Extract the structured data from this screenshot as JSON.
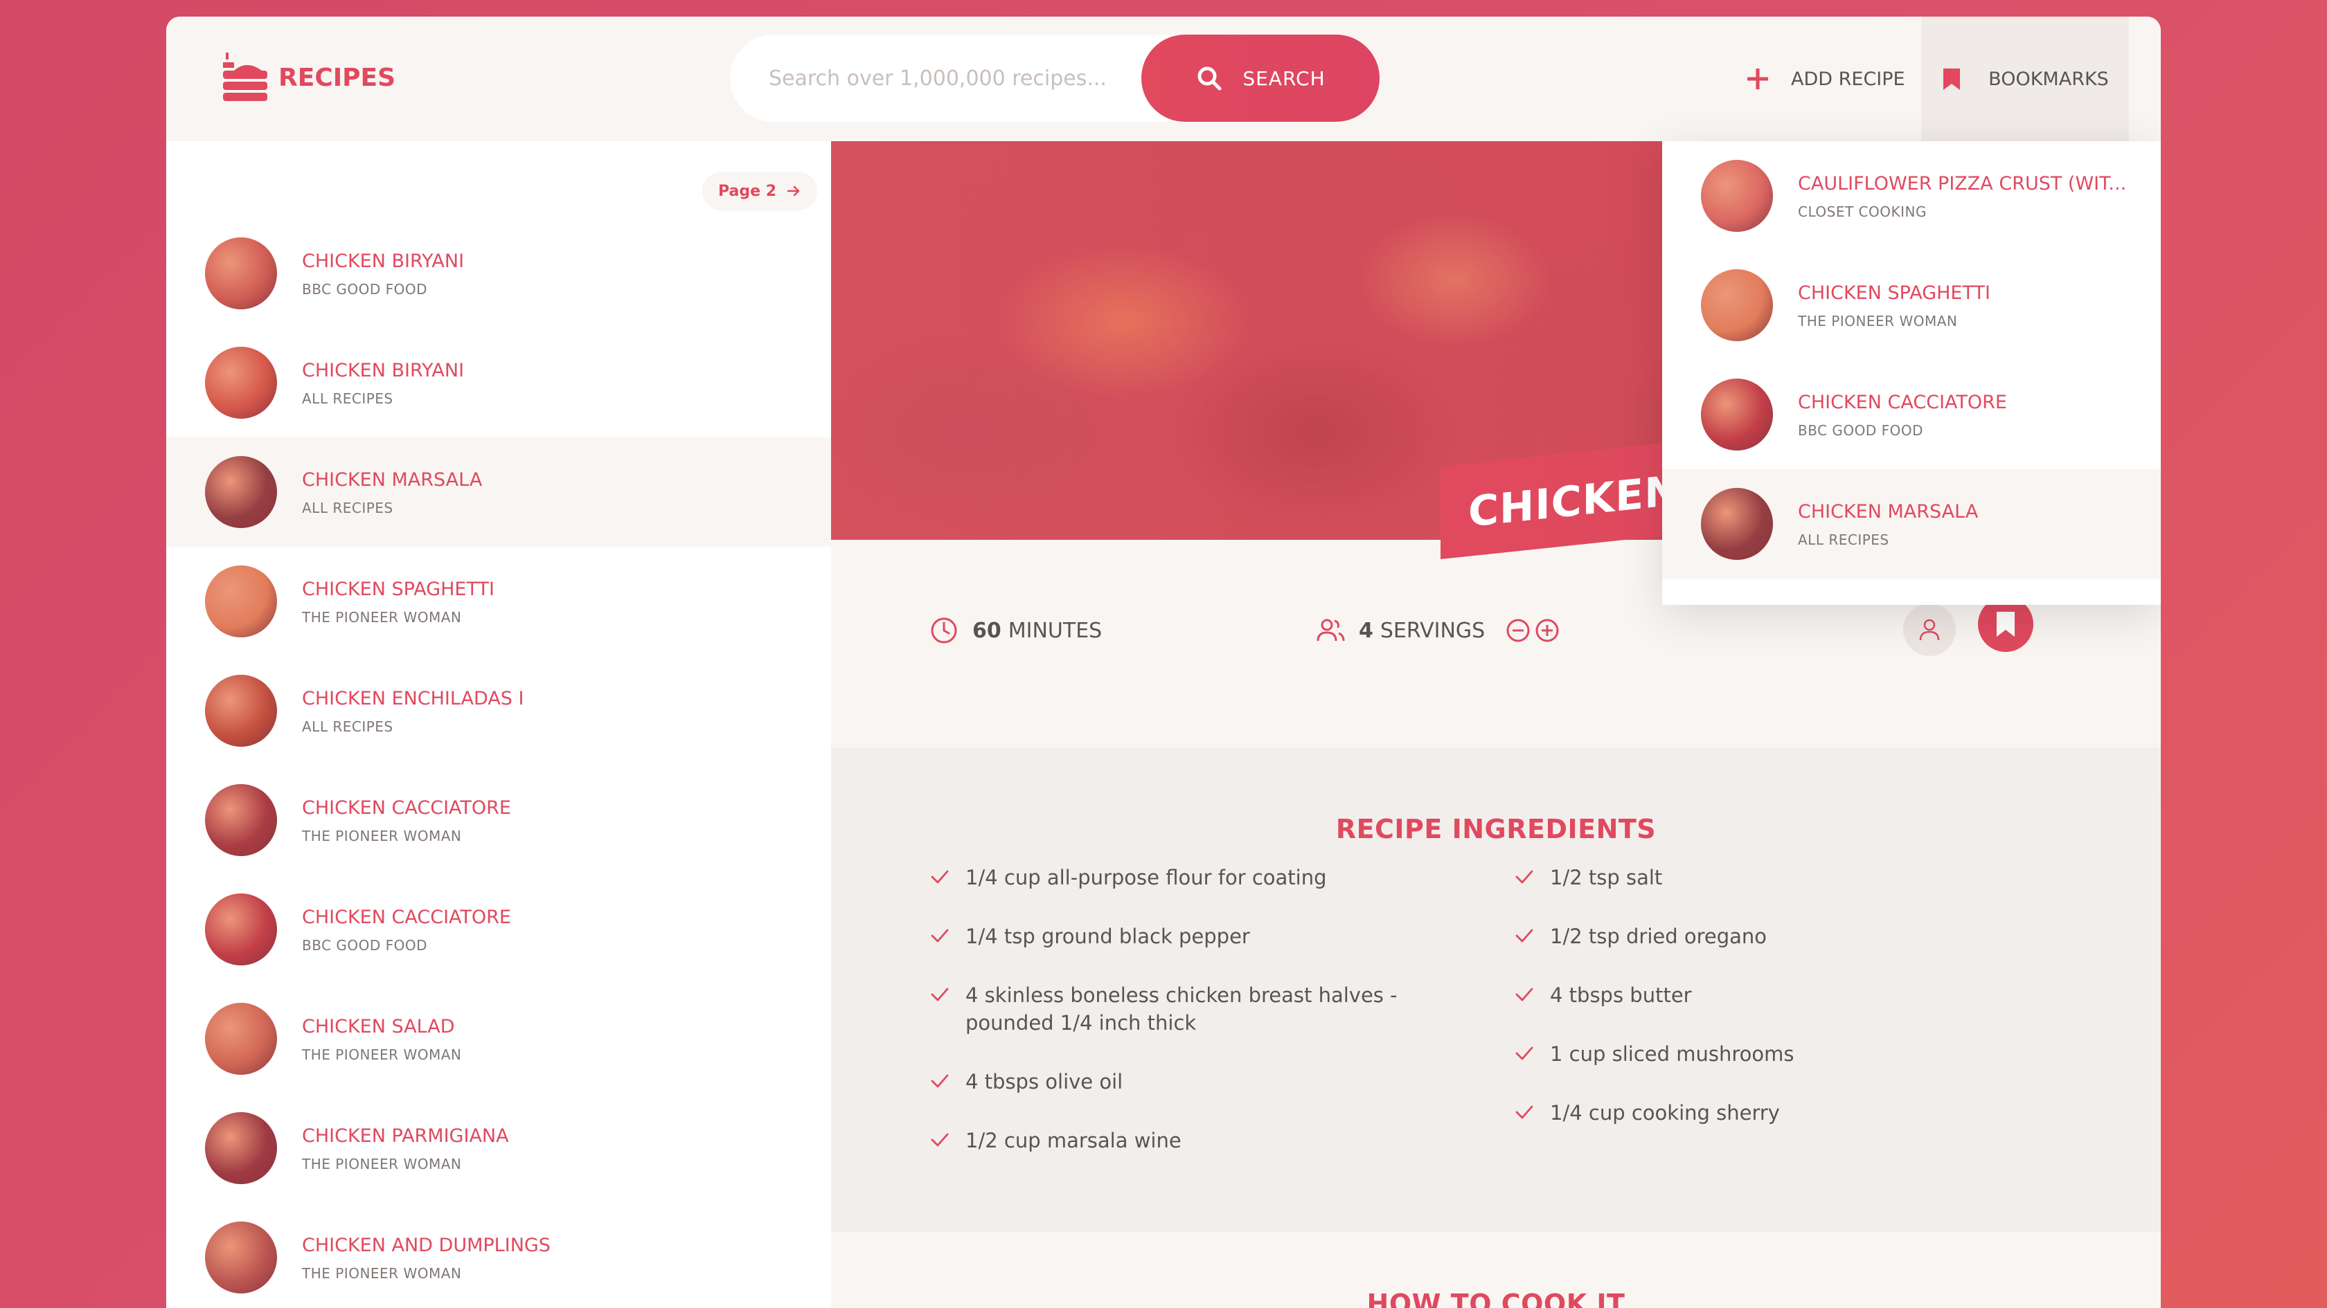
{
  "header": {
    "logo_text": "RECIPES",
    "search_placeholder": "Search over 1,000,000 recipes...",
    "search_button": "SEARCH",
    "add_recipe": "ADD RECIPE",
    "bookmarks": "BOOKMARKS"
  },
  "sidebar": {
    "page_button": "Page 2",
    "results": [
      {
        "title": "CHICKEN BIRYANI",
        "publisher": "BBC GOOD FOOD",
        "color": "#c96a4e",
        "active": false
      },
      {
        "title": "CHICKEN BIRYANI",
        "publisher": "ALL RECIPES",
        "color": "#d06040",
        "active": false
      },
      {
        "title": "CHICKEN MARSALA",
        "publisher": "ALL RECIPES",
        "color": "#6e3b35",
        "active": true
      },
      {
        "title": "CHICKEN SPAGHETTI",
        "publisher": "THE PIONEER WOMAN",
        "color": "#e29a5a",
        "active": false
      },
      {
        "title": "CHICKEN ENCHILADAS I",
        "publisher": "ALL RECIPES",
        "color": "#b5542e",
        "active": false
      },
      {
        "title": "CHICKEN CACCIATORE",
        "publisher": "THE PIONEER WOMAN",
        "color": "#8f3736",
        "active": false
      },
      {
        "title": "CHICKEN CACCIATORE",
        "publisher": "BBC GOOD FOOD",
        "color": "#b23a3c",
        "active": false
      },
      {
        "title": "CHICKEN SALAD",
        "publisher": "THE PIONEER WOMAN",
        "color": "#c87850",
        "active": false
      },
      {
        "title": "CHICKEN PARMIGIANA",
        "publisher": "THE PIONEER WOMAN",
        "color": "#7d3436",
        "active": false
      },
      {
        "title": "CHICKEN AND DUMPLINGS",
        "publisher": "THE PIONEER WOMAN",
        "color": "#a85e4a",
        "active": false
      }
    ]
  },
  "recipe": {
    "title": "CHICKEN MARSALA",
    "time_value": "60",
    "time_unit": "MINUTES",
    "servings_value": "4",
    "servings_unit": "SERVINGS",
    "ingredients_heading": "RECIPE INGREDIENTS",
    "ingredients_left": [
      "1/4 cup all-purpose flour for coating",
      "1/4 tsp ground black pepper",
      "4 skinless boneless chicken breast halves - pounded 1/4 inch thick",
      "4 tbsps olive oil",
      "1/2 cup marsala wine"
    ],
    "ingredients_right": [
      "1/2 tsp salt",
      "1/2 tsp dried oregano",
      "4 tbsps butter",
      "1 cup sliced mushrooms",
      "1/4 cup cooking sherry"
    ],
    "how_heading": "HOW TO COOK IT"
  },
  "bookmarks": [
    {
      "title": "CAULIFLOWER PIZZA CRUST (WIT...",
      "publisher": "CLOSET COOKING",
      "color": "#d97a66",
      "active": false
    },
    {
      "title": "CHICKEN SPAGHETTI",
      "publisher": "THE PIONEER WOMAN",
      "color": "#e29a5a",
      "active": false
    },
    {
      "title": "CHICKEN CACCIATORE",
      "publisher": "BBC GOOD FOOD",
      "color": "#b23a3c",
      "active": false
    },
    {
      "title": "CHICKEN MARSALA",
      "publisher": "ALL RECIPES",
      "color": "#6e3b35",
      "active": true
    }
  ],
  "colors": {
    "accent": "#e0495e",
    "background": "#f9f5f3",
    "text": "#555555"
  }
}
